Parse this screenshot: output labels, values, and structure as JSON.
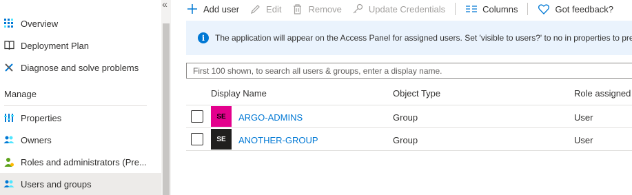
{
  "sidebar": {
    "collapse_glyph": "«",
    "items_top": [
      {
        "label": "Overview",
        "icon": "grid-icon"
      },
      {
        "label": "Deployment Plan",
        "icon": "book-icon"
      },
      {
        "label": "Diagnose and solve problems",
        "icon": "wrench-icon"
      }
    ],
    "section_manage": "Manage",
    "items_manage": [
      {
        "label": "Properties",
        "icon": "properties-icon"
      },
      {
        "label": "Owners",
        "icon": "people-icon"
      },
      {
        "label": "Roles and administrators (Pre...",
        "icon": "person-role-icon"
      },
      {
        "label": "Users and groups",
        "icon": "people-icon",
        "selected": true
      }
    ]
  },
  "toolbar": {
    "add_user": "Add user",
    "edit": "Edit",
    "remove": "Remove",
    "update_credentials": "Update Credentials",
    "columns": "Columns",
    "feedback": "Got feedback?"
  },
  "banner": {
    "text": "The application will appear on the Access Panel for assigned users. Set 'visible to users?' to no in properties to prev"
  },
  "search": {
    "placeholder": "First 100 shown, to search all users & groups, enter a display name."
  },
  "table": {
    "headers": {
      "display_name": "Display Name",
      "object_type": "Object Type",
      "role_assigned": "Role assigned"
    },
    "rows": [
      {
        "initials": "SE",
        "avatar_color": "#e3008c",
        "avatar_text_color": "#000000",
        "name": "ARGO-ADMINS",
        "type": "Group",
        "role": "User"
      },
      {
        "initials": "SE",
        "avatar_color": "#201f1e",
        "avatar_text_color": "#ffffff",
        "name": "ANOTHER-GROUP",
        "type": "Group",
        "role": "User"
      }
    ]
  },
  "colors": {
    "accent": "#0078d4",
    "selected_bg": "#edebe9",
    "banner_bg": "#eaf3fd"
  }
}
